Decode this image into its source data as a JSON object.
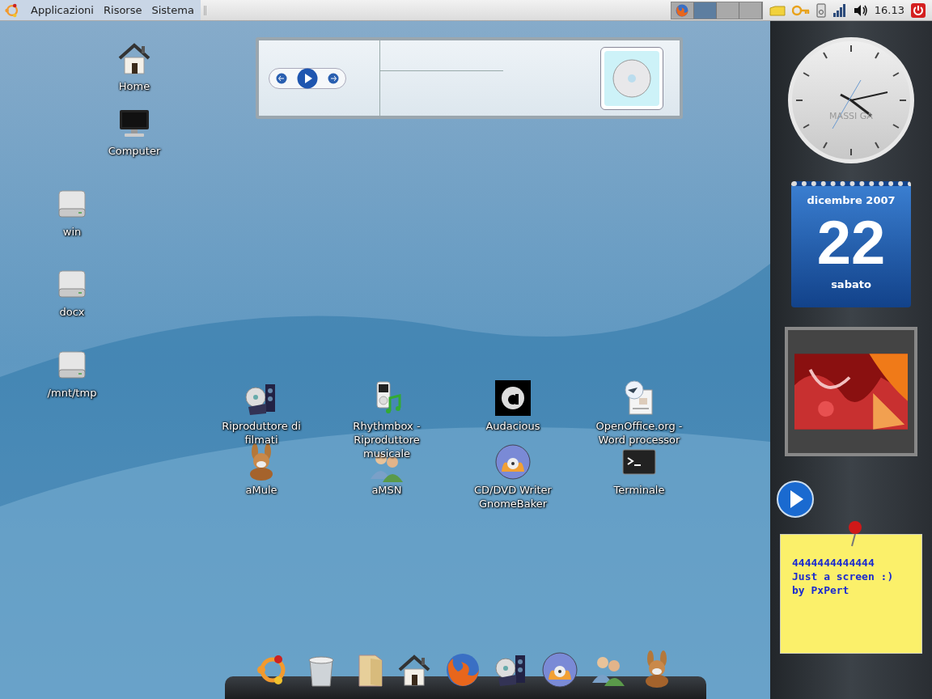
{
  "top_panel": {
    "menus": [
      "Applicazioni",
      "Risorse",
      "Sistema"
    ],
    "workspaces": [
      {
        "selected": false,
        "has_window": true
      },
      {
        "selected": true,
        "has_window": false
      },
      {
        "selected": false,
        "has_window": false
      },
      {
        "selected": false,
        "has_window": false
      }
    ],
    "clock": "16.13"
  },
  "desktop_icons": [
    {
      "label": "Home",
      "kind": "home"
    },
    {
      "label": "Computer",
      "kind": "computer"
    },
    {
      "label": "win",
      "kind": "drive"
    },
    {
      "label": "docx",
      "kind": "drive"
    },
    {
      "label": "/mnt/tmp",
      "kind": "drive"
    }
  ],
  "launchers": [
    {
      "label": "Riproduttore di filmati",
      "kind": "video"
    },
    {
      "label": "Rhythmbox - Riproduttore musicale",
      "kind": "music"
    },
    {
      "label": "Audacious",
      "kind": "audacious"
    },
    {
      "label": "OpenOffice.org - Word processor",
      "kind": "office"
    },
    {
      "label": "aMule",
      "kind": "amule"
    },
    {
      "label": "aMSN",
      "kind": "amsn"
    },
    {
      "label": "CD/DVD Writer GnomeBaker",
      "kind": "burner"
    },
    {
      "label": "Terminale",
      "kind": "terminal"
    }
  ],
  "dock": [
    {
      "kind": "ubuntu"
    },
    {
      "kind": "trash"
    },
    {
      "kind": "folder"
    },
    {
      "kind": "home"
    },
    {
      "kind": "firefox"
    },
    {
      "kind": "video"
    },
    {
      "kind": "burner"
    },
    {
      "kind": "amsn"
    },
    {
      "kind": "amule"
    }
  ],
  "clock_widget": {
    "brand": "MASSI GA"
  },
  "calendar_widget": {
    "month": "dicembre 2007",
    "day": "22",
    "weekday": "sabato"
  },
  "sticky_note": {
    "lines": [
      "4444444444444",
      "Just a screen :)",
      "by PxPert"
    ]
  }
}
